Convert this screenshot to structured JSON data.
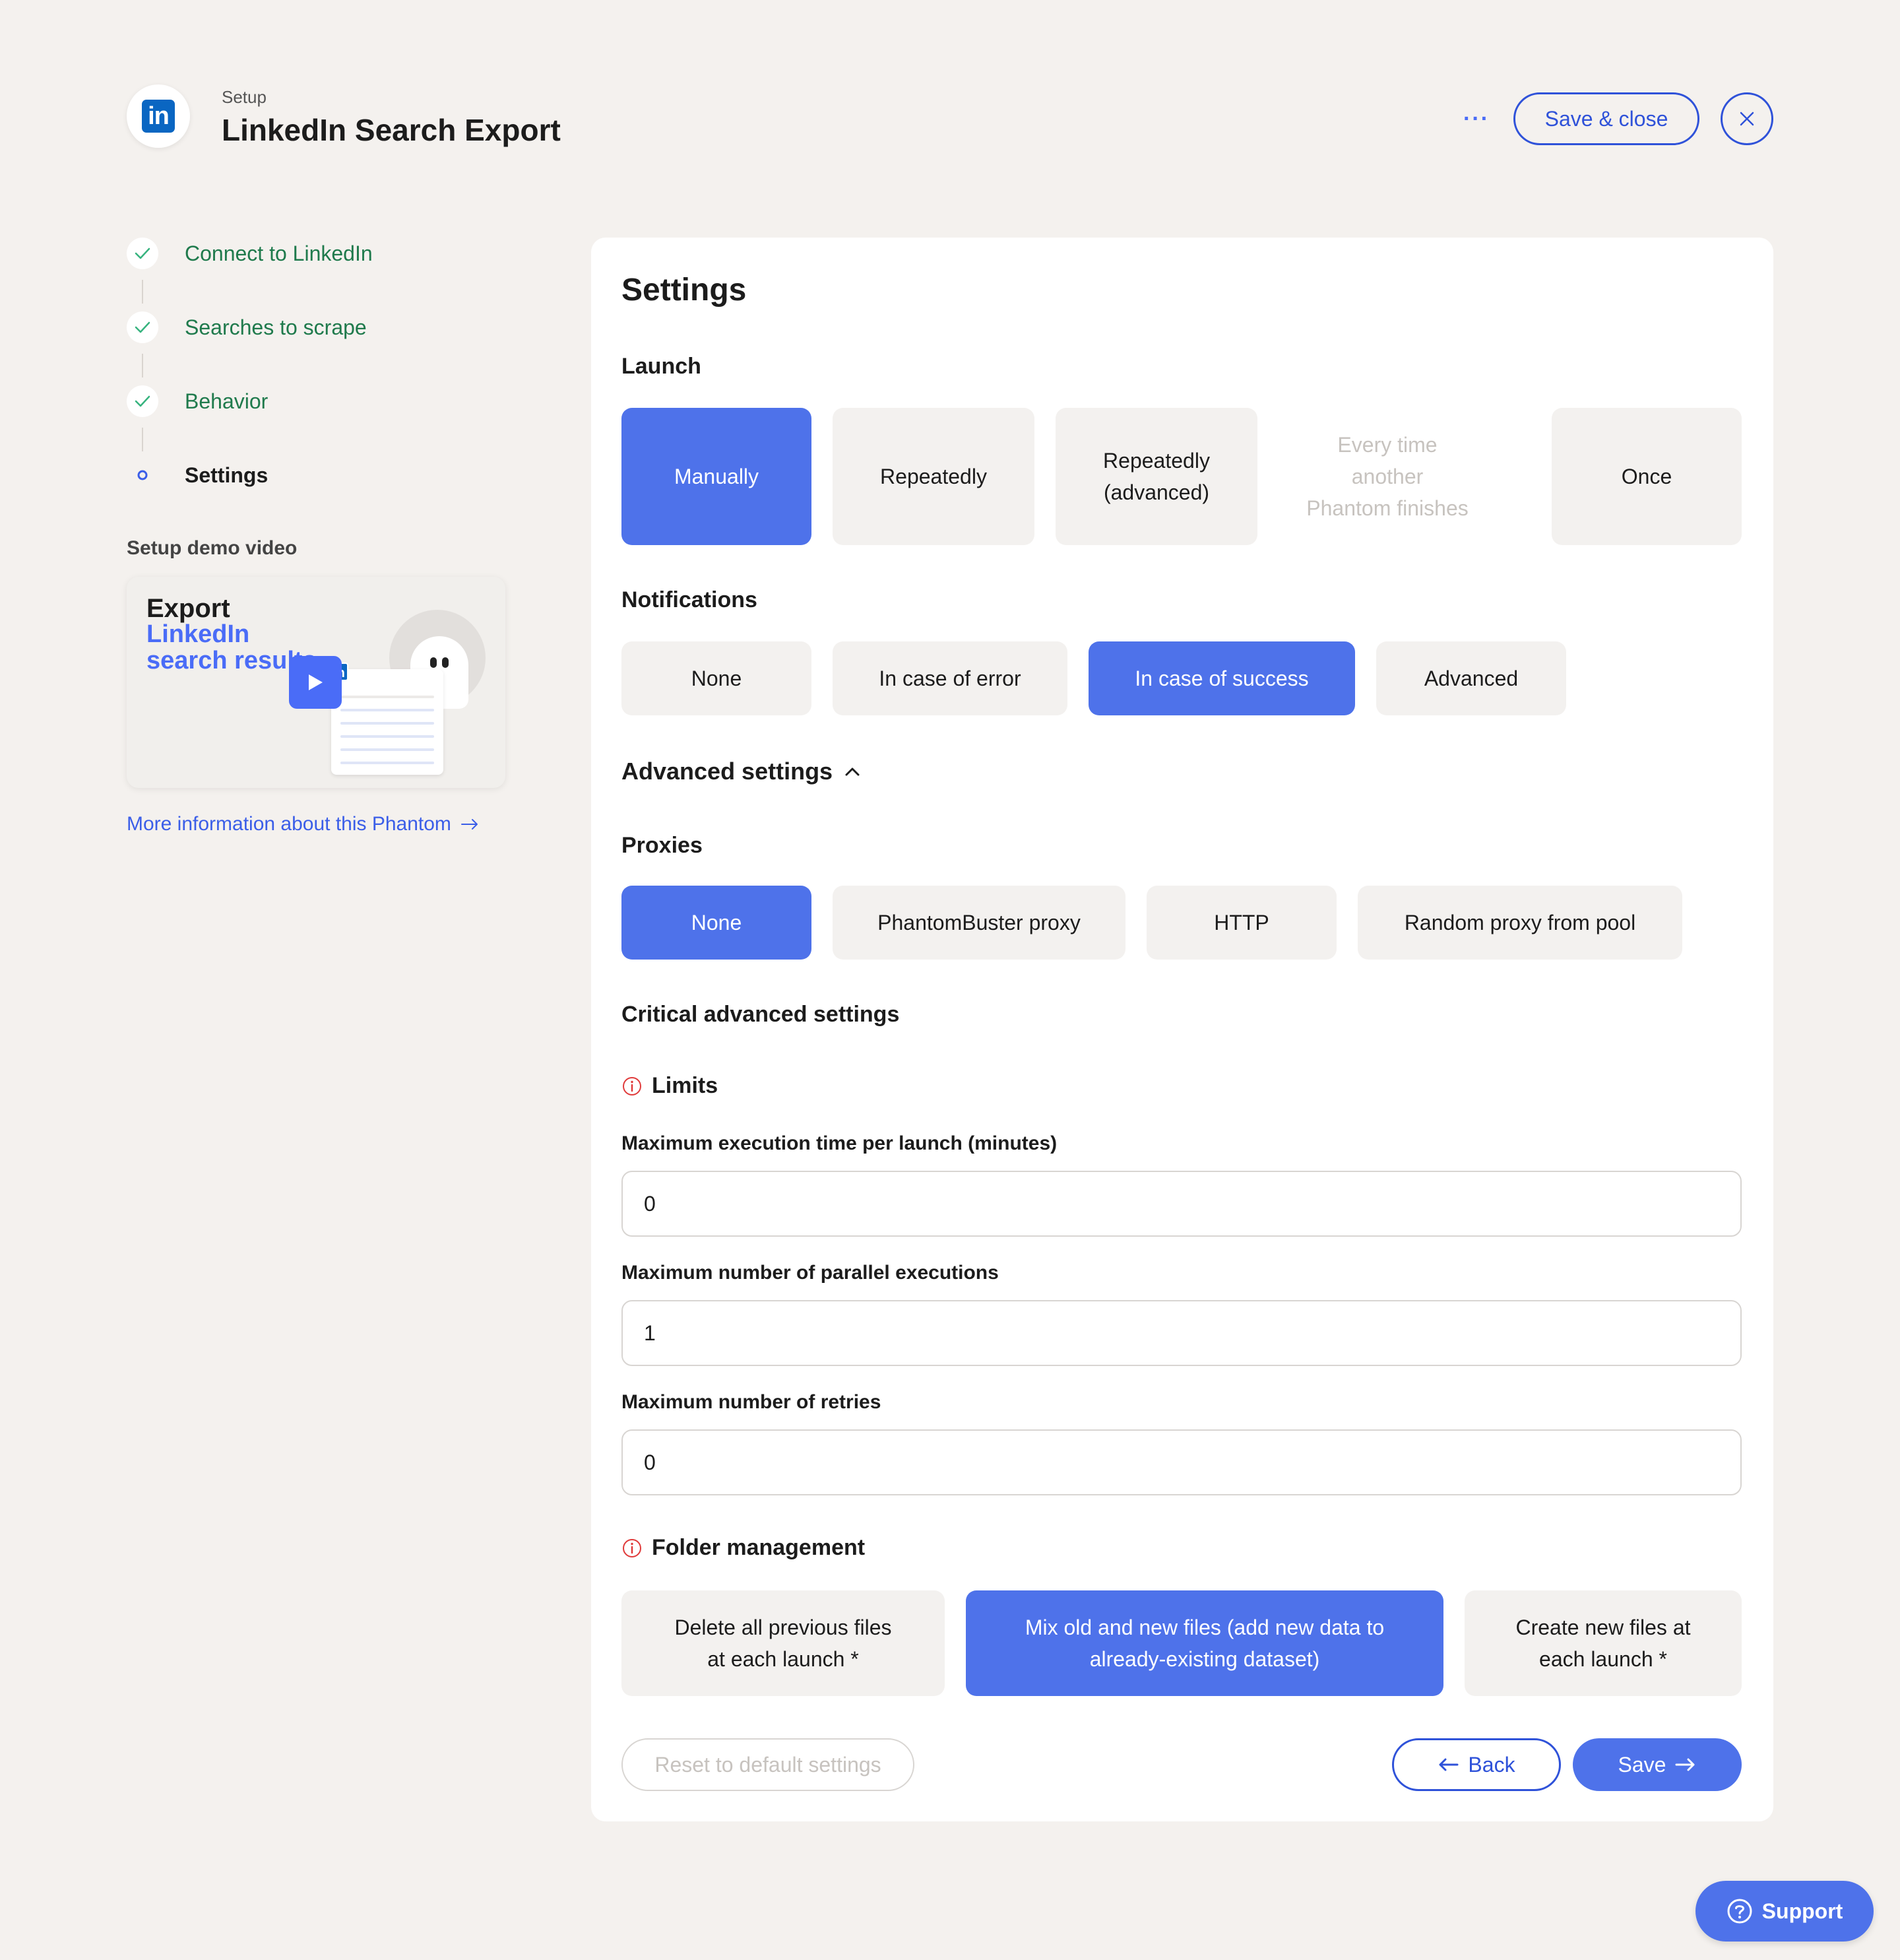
{
  "header": {
    "logo_text": "in",
    "subtitle": "Setup",
    "title": "LinkedIn Search Export",
    "more_label": "···",
    "save_close_label": "Save & close"
  },
  "steps": [
    {
      "label": "Connect to LinkedIn",
      "state": "done"
    },
    {
      "label": "Searches to scrape",
      "state": "done"
    },
    {
      "label": "Behavior",
      "state": "done"
    },
    {
      "label": "Settings",
      "state": "current"
    }
  ],
  "demo": {
    "heading": "Setup demo video",
    "line1": "Export",
    "line2": "LinkedIn",
    "line3": "search results",
    "more_info": "More information about this Phantom"
  },
  "settings": {
    "title": "Settings",
    "launch": {
      "label": "Launch",
      "options": [
        "Manually",
        "Repeatedly",
        "Repeatedly (advanced)",
        "Every time another Phantom finishes",
        "Once"
      ],
      "option_lines": [
        [
          "Manually"
        ],
        [
          "Repeatedly"
        ],
        [
          "Repeatedly",
          "(advanced)"
        ],
        [
          "Every time",
          "another",
          "Phantom finishes"
        ],
        [
          "Once"
        ]
      ],
      "selected": "Manually",
      "disabled": [
        "Every time another Phantom finishes"
      ]
    },
    "notifications": {
      "label": "Notifications",
      "options": [
        "None",
        "In case of error",
        "In case of success",
        "Advanced"
      ],
      "selected": "In case of success"
    },
    "advanced_toggle": "Advanced settings",
    "proxies": {
      "label": "Proxies",
      "options": [
        "None",
        "PhantomBuster proxy",
        "HTTP",
        "Random proxy from pool"
      ],
      "selected": "None"
    },
    "critical": {
      "label": "Critical advanced settings",
      "limits_label": "Limits",
      "max_exec_label": "Maximum execution time per launch (minutes)",
      "max_exec_value": "0",
      "max_parallel_label": "Maximum number of parallel executions",
      "max_parallel_value": "1",
      "max_retries_label": "Maximum number of retries",
      "max_retries_value": "0"
    },
    "folder": {
      "label": "Folder management",
      "options": [
        "Delete all previous files at each launch *",
        "Mix old and new files (add new data to already-existing dataset)",
        "Create new files at each launch *"
      ],
      "option_lines": [
        [
          "Delete all previous files",
          "at each launch *"
        ],
        [
          "Mix old and new files (add new data to",
          "already-existing dataset)"
        ],
        [
          "Create new files at",
          "each launch *"
        ]
      ],
      "selected": "Mix old and new files (add new data to already-existing dataset)"
    },
    "buttons": {
      "reset": "Reset to default settings",
      "back": "Back",
      "save": "Save"
    }
  },
  "support": {
    "label": "Support"
  },
  "colors": {
    "accent": "#4e72ea",
    "accent_dark": "#2f52d9",
    "success": "#1f7a4c",
    "background": "#f4f1ee",
    "warning": "#e03a3a",
    "linkedin": "#0a66c2"
  },
  "icons": {
    "check": "check-icon",
    "close": "close-icon",
    "play": "play-icon",
    "arrow_right": "arrow-right-icon",
    "arrow_left": "arrow-left-icon",
    "chevron_up": "chevron-up-icon",
    "info": "info-icon",
    "help": "help-circle-icon"
  }
}
